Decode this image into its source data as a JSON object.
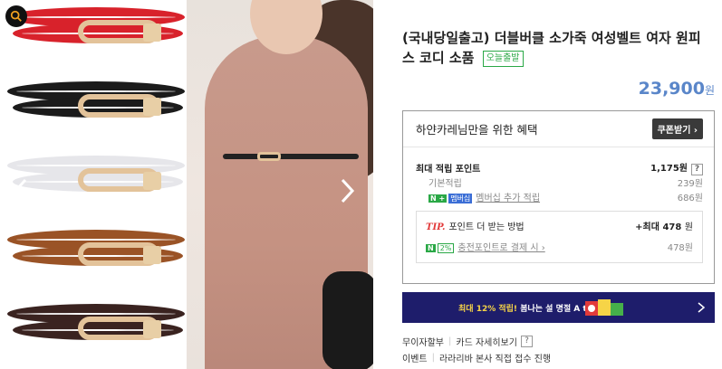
{
  "gallery": {
    "zoom_icon": "search-icon",
    "prev_icon": "chevron-left-icon",
    "next_icon": "chevron-right-icon",
    "belt_colors": [
      "#d8222b",
      "#1b1b1b",
      "#e6e6ea",
      "#9a5326",
      "#3a2320"
    ]
  },
  "product": {
    "title": "(국내당일출고) 더블버클 소가죽 여성벨트 여자 원피스 코디 소품",
    "badge": "오늘출발",
    "price": "23,900",
    "price_unit": "원"
  },
  "benefit": {
    "heading": "하얀카레님만을 위한 혜택",
    "coupon_button": "쿠폰받기 ›",
    "max_points_label": "최대 적립 포인트",
    "max_points_value": "1,175원",
    "help": "?",
    "basic_label": "기본적립",
    "basic_value": "239원",
    "member_mark": "N +",
    "member_tag": "멤버십",
    "member_label": "멤버십 추가 적립",
    "member_value": "686원",
    "tip_mark": "TIP.",
    "tip_label": "포인트 더 받는 방법",
    "tip_value_prefix": "+최대",
    "tip_value": "478",
    "tip_unit": "원",
    "charge_mark": "N",
    "charge_pct": "2%",
    "charge_label": "충전포인트로 결제 시 ›",
    "charge_value": "478원"
  },
  "banner": {
    "text_yellow": "최대 12% 적립!",
    "text_white": "봄나는 설 명절 A to Z",
    "accent": "#1e1d6b"
  },
  "links": {
    "installment": "무이자할부",
    "card_detail": "카드 자세히보기",
    "help": "?",
    "event": "이벤트",
    "event_detail": "라라리바 본사 직접 접수 진행"
  }
}
